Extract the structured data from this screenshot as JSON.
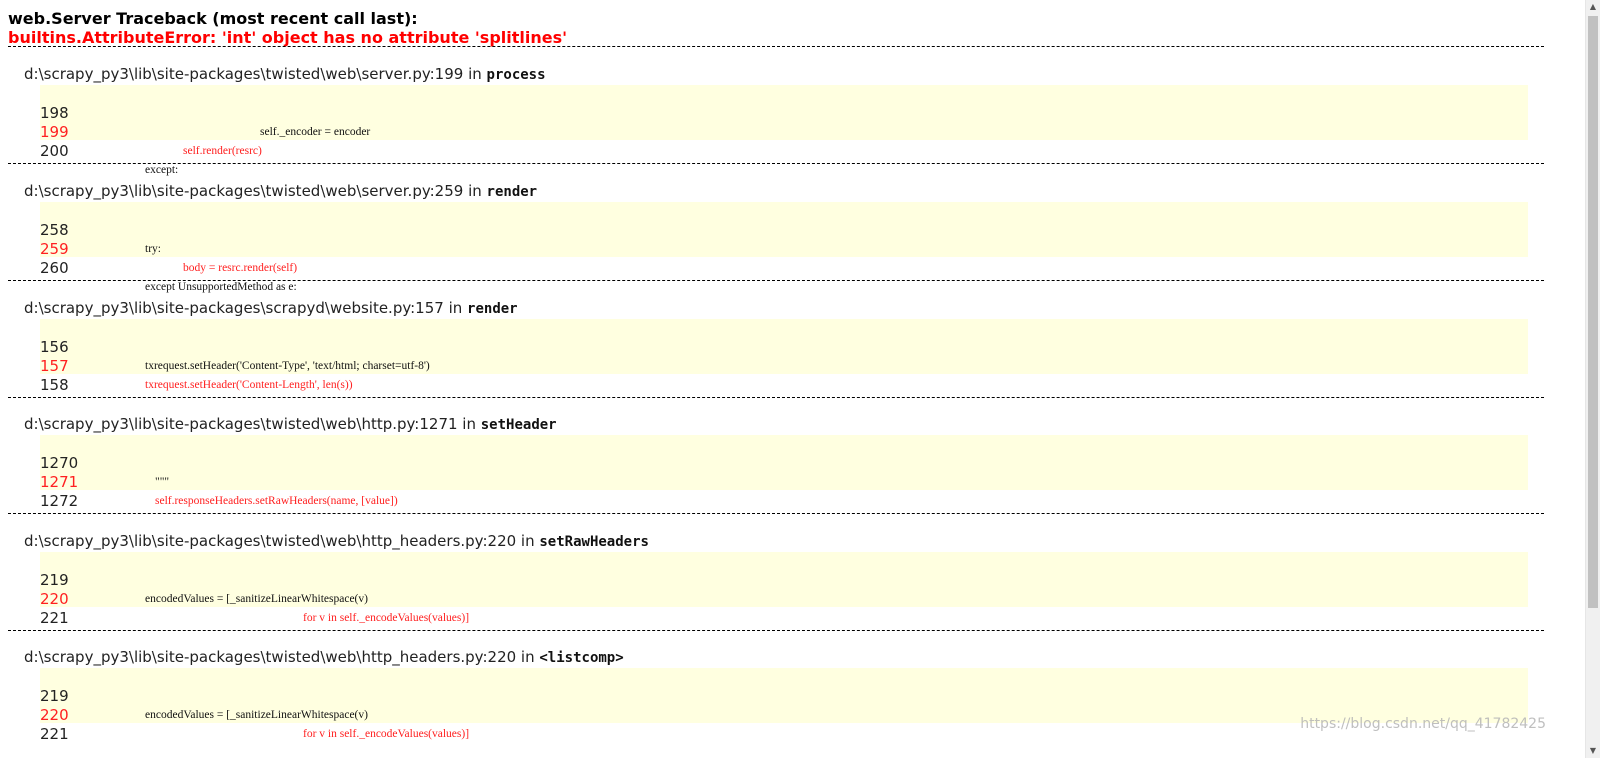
{
  "header": {
    "title": "web.Server Traceback (most recent call last):",
    "error": "builtins.AttributeError: 'int' object has no attribute 'splitlines'"
  },
  "frames": [
    {
      "location": "d:\\scrapy_py3\\lib\\site-packages\\twisted\\web\\server.py:199 in ",
      "function": "process",
      "lines": [
        {
          "no": "198",
          "code": "self._encoder = encoder",
          "highlight": false
        },
        {
          "no": "199",
          "code": "self.render(resrc)",
          "highlight": true
        },
        {
          "no": "200",
          "code": "except:",
          "highlight": false
        }
      ]
    },
    {
      "location": "d:\\scrapy_py3\\lib\\site-packages\\twisted\\web\\server.py:259 in ",
      "function": "render",
      "lines": [
        {
          "no": "258",
          "code": "try:",
          "highlight": false
        },
        {
          "no": "259",
          "code": "body = resrc.render(self)",
          "highlight": true
        },
        {
          "no": "260",
          "code": "except UnsupportedMethod as e:",
          "highlight": false
        }
      ]
    },
    {
      "location": "d:\\scrapy_py3\\lib\\site-packages\\scrapyd\\website.py:157 in ",
      "function": "render",
      "lines": [
        {
          "no": "156",
          "code": "txrequest.setHeader('Content-Type', 'text/html; charset=utf-8')",
          "highlight": false
        },
        {
          "no": "157",
          "code": "txrequest.setHeader('Content-Length', len(s))",
          "highlight": true
        },
        {
          "no": "158",
          "code": "",
          "highlight": false
        }
      ]
    },
    {
      "location": "d:\\scrapy_py3\\lib\\site-packages\\twisted\\web\\http.py:1271 in ",
      "function": "setHeader",
      "lines": [
        {
          "no": "1270",
          "code": "\"\"\"",
          "highlight": false
        },
        {
          "no": "1271",
          "code": "self.responseHeaders.setRawHeaders(name, [value])",
          "highlight": true
        },
        {
          "no": "1272",
          "code": "",
          "highlight": false
        }
      ]
    },
    {
      "location": "d:\\scrapy_py3\\lib\\site-packages\\twisted\\web\\http_headers.py:220 in ",
      "function": "setRawHeaders",
      "lines": [
        {
          "no": "219",
          "code": "encodedValues = [_sanitizeLinearWhitespace(v)",
          "highlight": false
        },
        {
          "no": "220",
          "code": "for v in self._encodeValues(values)]",
          "highlight": true
        },
        {
          "no": "221",
          "code": "",
          "highlight": false
        }
      ]
    },
    {
      "location": "d:\\scrapy_py3\\lib\\site-packages\\twisted\\web\\http_headers.py:220 in ",
      "function": "<listcomp>",
      "lines": [
        {
          "no": "219",
          "code": "encodedValues = [_sanitizeLinearWhitespace(v)",
          "highlight": false
        },
        {
          "no": "220",
          "code": "for v in self._encodeValues(values)]",
          "highlight": true
        },
        {
          "no": "221",
          "code": "",
          "highlight": false
        }
      ]
    }
  ],
  "watermark": "https://blog.csdn.net/qq_41782425",
  "colors": {
    "error": "#ff0000",
    "code_background": "#ffffe0"
  }
}
